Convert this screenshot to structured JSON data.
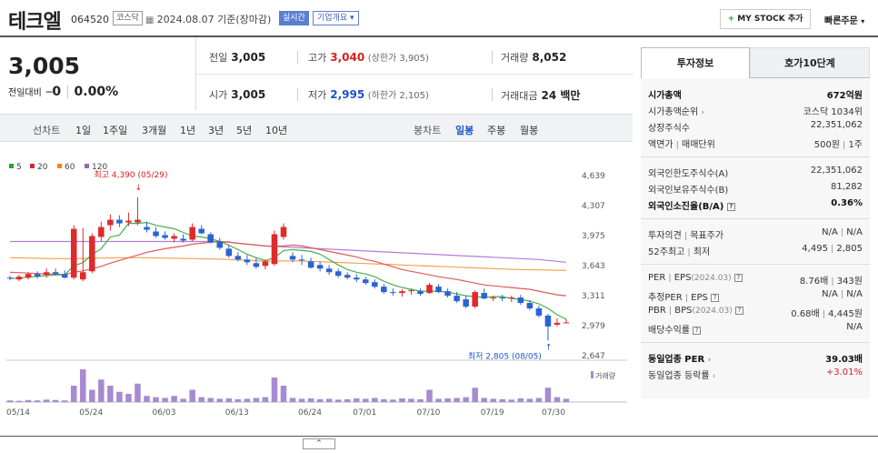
{
  "header": {
    "name": "테크엘",
    "code": "064520",
    "market": "코스닥",
    "date_text": "2024.08.07 기준(장마감)",
    "realtime": "실시간",
    "overview": "기업개요",
    "mystock": "MY STOCK 추가",
    "quick_order": "빠른주문"
  },
  "price": {
    "current": "3,005",
    "change_label": "전일대비",
    "change": "0",
    "change_pct": "0.00%"
  },
  "summary": {
    "prev_label": "전일",
    "prev": "3,005",
    "high_label": "고가",
    "high": "3,040",
    "upper_label": "(상한가 3,905)",
    "volume_label": "거래량",
    "volume": "8,052",
    "open_label": "시가",
    "open": "3,005",
    "low_label": "저가",
    "low": "2,995",
    "lower_label": "(하한가 2,105)",
    "amount_label": "거래대금",
    "amount": "24 백만"
  },
  "periods": {
    "line_label": "선차트",
    "items": [
      "1일",
      "1주일",
      "3개월",
      "1년",
      "3년",
      "5년",
      "10년"
    ],
    "candle_label": "봉차트",
    "candle_items": [
      "일봉",
      "주봉",
      "월봉"
    ]
  },
  "chart_data": {
    "type": "candlestick",
    "legend": [
      {
        "name": "5",
        "color": "#2ca02c"
      },
      {
        "name": "20",
        "color": "#d62728"
      },
      {
        "name": "60",
        "color": "#ff7f0e"
      },
      {
        "name": "120",
        "color": "#9467bd"
      }
    ],
    "y_ticks": [
      "4,639",
      "4,307",
      "3,975",
      "3,643",
      "3,311",
      "2,979",
      "2,647"
    ],
    "ylim": [
      2647,
      4639
    ],
    "x_ticks": [
      "05/14",
      "05/24",
      "06/03",
      "06/13",
      "06/24",
      "07/01",
      "07/10",
      "07/19",
      "07/30"
    ],
    "high_annotation": "최고 4,390 (05/29)",
    "low_annotation": "최저 2,805 (08/05)",
    "volume_label": "거래량",
    "candles": [
      [
        3500,
        3520,
        3470,
        3490
      ],
      [
        3480,
        3530,
        3460,
        3510
      ],
      [
        3500,
        3560,
        3480,
        3540
      ],
      [
        3540,
        3570,
        3490,
        3510
      ],
      [
        3530,
        3600,
        3500,
        3560
      ],
      [
        3560,
        3600,
        3520,
        3540
      ],
      [
        3540,
        3580,
        3490,
        3500
      ],
      [
        3500,
        4080,
        3480,
        4040
      ],
      [
        3480,
        4050,
        3460,
        3560
      ],
      [
        3570,
        3990,
        3550,
        3960
      ],
      [
        3950,
        4120,
        3900,
        4060
      ],
      [
        4080,
        4200,
        4020,
        4140
      ],
      [
        4140,
        4190,
        4060,
        4100
      ],
      [
        4110,
        4220,
        4070,
        4130
      ],
      [
        4110,
        4390,
        4080,
        4140
      ],
      [
        4060,
        4120,
        4000,
        4030
      ],
      [
        4010,
        4060,
        3940,
        3960
      ],
      [
        3970,
        4010,
        3920,
        3940
      ],
      [
        3930,
        3990,
        3890,
        3960
      ],
      [
        3930,
        3980,
        3890,
        3910
      ],
      [
        3920,
        4100,
        3900,
        4060
      ],
      [
        4040,
        4080,
        3980,
        3990
      ],
      [
        3980,
        4000,
        3880,
        3890
      ],
      [
        3900,
        3940,
        3810,
        3830
      ],
      [
        3820,
        3860,
        3720,
        3740
      ],
      [
        3740,
        3780,
        3680,
        3700
      ],
      [
        3700,
        3750,
        3640,
        3670
      ],
      [
        3660,
        3720,
        3600,
        3620
      ],
      [
        3630,
        3700,
        3590,
        3680
      ],
      [
        3650,
        4020,
        3630,
        3980
      ],
      [
        3950,
        4100,
        3920,
        4060
      ],
      [
        3740,
        3780,
        3670,
        3700
      ],
      [
        3700,
        3750,
        3640,
        3690
      ],
      [
        3680,
        3720,
        3600,
        3610
      ],
      [
        3640,
        3680,
        3570,
        3600
      ],
      [
        3600,
        3640,
        3530,
        3560
      ],
      [
        3570,
        3600,
        3500,
        3520
      ],
      [
        3530,
        3560,
        3480,
        3500
      ],
      [
        3500,
        3540,
        3450,
        3480
      ],
      [
        3480,
        3510,
        3420,
        3440
      ],
      [
        3450,
        3480,
        3380,
        3400
      ],
      [
        3400,
        3430,
        3320,
        3340
      ],
      [
        3340,
        3380,
        3300,
        3330
      ],
      [
        3330,
        3370,
        3290,
        3350
      ],
      [
        3350,
        3380,
        3310,
        3360
      ],
      [
        3350,
        3380,
        3300,
        3320
      ],
      [
        3330,
        3440,
        3320,
        3420
      ],
      [
        3400,
        3430,
        3330,
        3340
      ],
      [
        3350,
        3380,
        3280,
        3300
      ],
      [
        3300,
        3340,
        3220,
        3240
      ],
      [
        3260,
        3300,
        3160,
        3180
      ],
      [
        3180,
        3360,
        3160,
        3340
      ],
      [
        3330,
        3380,
        3260,
        3270
      ],
      [
        3270,
        3300,
        3240,
        3280
      ],
      [
        3280,
        3310,
        3240,
        3270
      ],
      [
        3270,
        3300,
        3230,
        3280
      ],
      [
        3280,
        3310,
        3200,
        3220
      ],
      [
        3220,
        3250,
        3140,
        3160
      ],
      [
        3160,
        3190,
        3060,
        3080
      ],
      [
        3080,
        3100,
        2805,
        2960
      ],
      [
        2980,
        3050,
        2960,
        3000
      ],
      [
        3005,
        3040,
        2995,
        3005
      ]
    ],
    "ma5": [
      3490,
      3495,
      3505,
      3515,
      3522,
      3530,
      3530,
      3632,
      3666,
      3756,
      3820,
      3950,
      3970,
      4100,
      4100,
      4110,
      4080,
      4060,
      4040,
      4000,
      3960,
      3950,
      3930,
      3900,
      3860,
      3810,
      3760,
      3720,
      3690,
      3720,
      3800,
      3810,
      3800,
      3790,
      3760,
      3700,
      3640,
      3590,
      3560,
      3540,
      3510,
      3460,
      3420,
      3390,
      3370,
      3350,
      3350,
      3350,
      3340,
      3320,
      3300,
      3290,
      3280,
      3290,
      3290,
      3270,
      3260,
      3240,
      3210,
      3160,
      3090,
      3040
    ],
    "ma20": [
      3560,
      3555,
      3550,
      3545,
      3540,
      3538,
      3535,
      3560,
      3575,
      3600,
      3625,
      3660,
      3690,
      3720,
      3750,
      3780,
      3800,
      3820,
      3835,
      3850,
      3870,
      3880,
      3890,
      3900,
      3895,
      3880,
      3870,
      3860,
      3850,
      3845,
      3850,
      3860,
      3850,
      3830,
      3810,
      3790,
      3770,
      3750,
      3730,
      3700,
      3680,
      3650,
      3620,
      3590,
      3570,
      3550,
      3530,
      3510,
      3495,
      3480,
      3460,
      3440,
      3420,
      3410,
      3400,
      3390,
      3380,
      3370,
      3350,
      3330,
      3310,
      3300
    ],
    "ma60": [
      3720,
      3718,
      3716,
      3714,
      3712,
      3710,
      3708,
      3710,
      3712,
      3714,
      3716,
      3718,
      3720,
      3720,
      3720,
      3720,
      3718,
      3716,
      3714,
      3712,
      3710,
      3708,
      3706,
      3704,
      3700,
      3696,
      3692,
      3688,
      3684,
      3682,
      3684,
      3686,
      3684,
      3680,
      3676,
      3672,
      3668,
      3664,
      3660,
      3656,
      3652,
      3648,
      3644,
      3640,
      3636,
      3632,
      3628,
      3624,
      3620,
      3616,
      3612,
      3608,
      3604,
      3600,
      3596,
      3592,
      3590,
      3588,
      3586,
      3584,
      3582,
      3580
    ],
    "ma120": [
      3900,
      3900,
      3900,
      3900,
      3900,
      3900,
      3900,
      3900,
      3900,
      3900,
      3900,
      3900,
      3900,
      3900,
      3900,
      3900,
      3900,
      3900,
      3900,
      3900,
      3900,
      3900,
      3900,
      3895,
      3890,
      3880,
      3870,
      3860,
      3850,
      3845,
      3840,
      3835,
      3830,
      3825,
      3820,
      3815,
      3810,
      3805,
      3800,
      3795,
      3790,
      3785,
      3780,
      3775,
      3770,
      3765,
      3760,
      3755,
      3750,
      3745,
      3740,
      3735,
      3730,
      3725,
      3720,
      3715,
      3710,
      3705,
      3700,
      3690,
      3680,
      3670
    ],
    "volumes": [
      4,
      3,
      5,
      4,
      6,
      5,
      4,
      40,
      80,
      30,
      55,
      40,
      25,
      20,
      45,
      15,
      12,
      10,
      15,
      8,
      30,
      12,
      10,
      8,
      9,
      7,
      8,
      10,
      12,
      60,
      40,
      10,
      8,
      9,
      7,
      8,
      6,
      7,
      9,
      8,
      10,
      7,
      6,
      9,
      8,
      7,
      30,
      8,
      9,
      10,
      12,
      35,
      10,
      8,
      7,
      6,
      9,
      8,
      10,
      35,
      12,
      8
    ]
  },
  "tabs": {
    "info": "투자정보",
    "ask": "호가10단계"
  },
  "invest": {
    "market_cap": {
      "label": "시가총액",
      "value": "672억원"
    },
    "cap_rank": {
      "label": "시가총액순위",
      "value": "코스닥 1034위"
    },
    "shares": {
      "label": "상장주식수",
      "value": "22,351,062"
    },
    "par": {
      "label": "액면가",
      "label2": "매매단위",
      "value": "500원",
      "value2": "1주"
    },
    "foreign_limit": {
      "label": "외국인한도주식수(A)",
      "value": "22,351,062"
    },
    "foreign_hold": {
      "label": "외국인보유주식수(B)",
      "value": "81,282"
    },
    "foreign_ratio": {
      "label": "외국인소진율(B/A)",
      "value": "0.36%"
    },
    "opinion": {
      "label": "투자의견",
      "label2": "목표주가",
      "value": "N/A",
      "value2": "N/A"
    },
    "week52": {
      "label": "52주최고",
      "label2": "최저",
      "value": "4,495",
      "value2": "2,805"
    },
    "per": {
      "label": "PER",
      "label2": "EPS",
      "date": "(2024.03)",
      "value": "8.76배",
      "value2": "343원"
    },
    "est_per": {
      "label": "추정PER",
      "label2": "EPS",
      "value": "N/A",
      "value2": "N/A"
    },
    "pbr": {
      "label": "PBR",
      "label2": "BPS",
      "date": "(2024.03)",
      "value": "0.68배",
      "value2": "4,445원"
    },
    "dividend": {
      "label": "배당수익률",
      "value": "N/A"
    },
    "industry_per": {
      "label": "동일업종 PER",
      "value": "39.03배"
    },
    "industry_rate": {
      "label": "동일업종 등락률",
      "value": "+3.01%"
    }
  },
  "toggle": "⌃"
}
